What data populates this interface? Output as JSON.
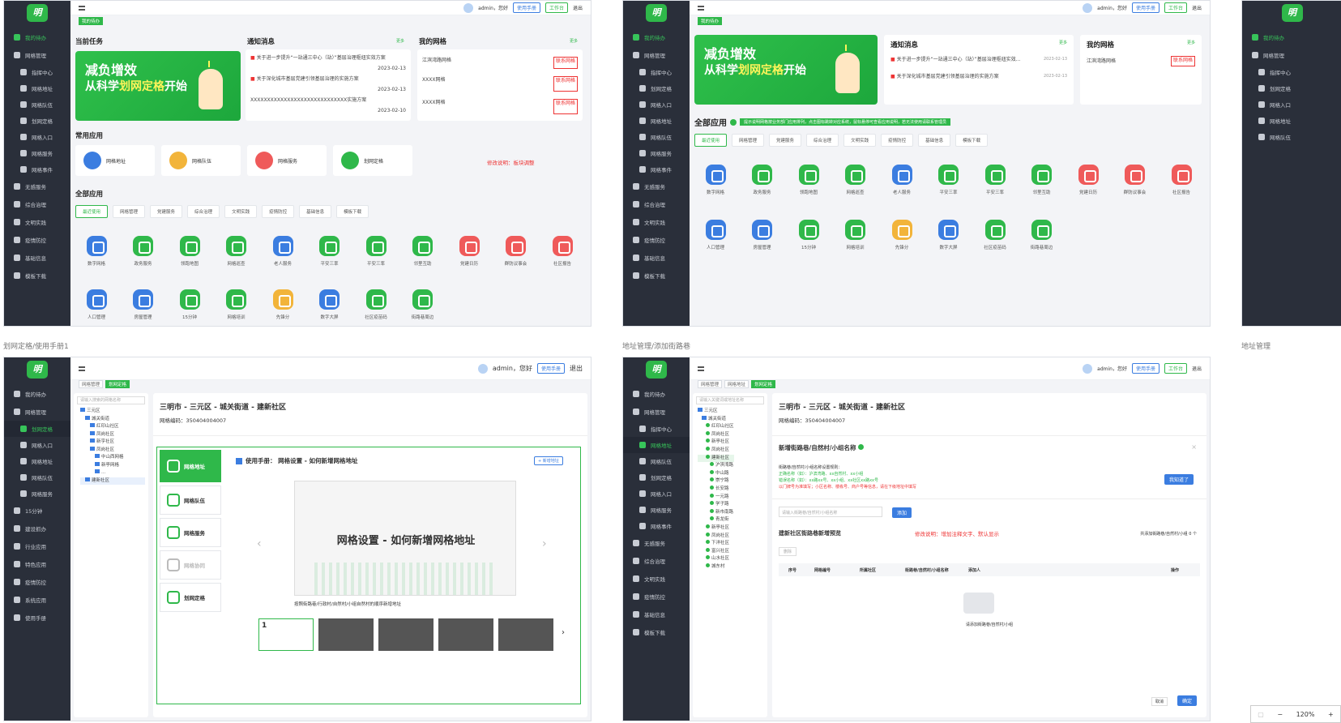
{
  "captions": {
    "bl": "划网定格/使用手册1",
    "br": "地址管理/添加街路巷",
    "far_right_1": "地址管理",
    "far_right_2": ""
  },
  "header": {
    "user": "admin，您好",
    "manual_btn": "使用手册",
    "workorder_btn": "工作台",
    "logout": "退出"
  },
  "sidebar_a": [
    "我的待办",
    "网格管理",
    "指挥中心",
    "网格地址",
    "网格队伍",
    "划网定格",
    "网格入口",
    "网格服务",
    "网格事件",
    "无感服务",
    "综合治理",
    "文明实践",
    "疫情防控",
    "基础信息",
    "模板下载"
  ],
  "sidebar_c": [
    "我的待办",
    "网格管理",
    "划网定格",
    "网格入口",
    "网格地址",
    "网格队伍",
    "网格服务",
    "15分钟",
    "建设抓办",
    "行业应用",
    "特色应用",
    "疫情防控",
    "系统应用",
    "使用手册"
  ],
  "sidebar_d": [
    "我的待办",
    "网格管理",
    "指挥中心",
    "网格地址",
    "网格队伍",
    "划网定格",
    "网格入口",
    "网格服务",
    "网格事件",
    "无感服务",
    "综合治理",
    "文明实践",
    "疫情防控",
    "基础信息",
    "模板下载"
  ],
  "tl": {
    "crumb": "我的待办",
    "current_task": "当前任务",
    "notice": "通知消息",
    "my_grid": "我的网格",
    "more": "更多",
    "banner1": "减负增效",
    "banner2_pre": "从科学",
    "banner2_hl": "划网定格",
    "banner2_post": "开始",
    "notices": [
      {
        "text": "关于进一步提升“一站通三中心（站）”基层治理枢纽实效方案",
        "date": "2023-02-13"
      },
      {
        "text": "关于深化城市基层党建引领基层治理的实施方案",
        "date": "2023-02-13"
      },
      {
        "text": "XXXXXXXXXXXXXXXXXXXXXXXXXXXXX实施方案",
        "date": "2023-02-10"
      }
    ],
    "grids": [
      {
        "name": "江滨湾路网格",
        "tag": "联系网格"
      },
      {
        "name": "XXXX网格",
        "tag": "联系网格"
      },
      {
        "name": "XXXX网格",
        "tag": "联系网格"
      }
    ],
    "common_apps": "常用应用",
    "commons": [
      "网格地址",
      "网格队伍",
      "网格服务",
      "划网定格"
    ],
    "modify_note": "修改说明：板块调整",
    "all_apps": "全部应用",
    "cats": [
      "最近使用",
      "网格管理",
      "党建服务",
      "综合治理",
      "文明实践",
      "疫情防控",
      "基础信息",
      "模板下载"
    ],
    "apps1": [
      "数字网格",
      "政务服务",
      "领跑地图",
      "网格巡查",
      "老人服务",
      "平安三率",
      "平安三率",
      "邻里互助",
      "党建日历",
      "群防议事会",
      "社区报告"
    ],
    "apps2": [
      "人口管理",
      "房屋管理",
      "15分钟",
      "网格培训",
      "先锋分",
      "数字大屏",
      "社区疫苗码",
      "街路巷周边"
    ]
  },
  "tr": {
    "crumb": "我的待办",
    "notice": "通知消息",
    "my_grid": "我的网格",
    "more": "更多",
    "notices": [
      {
        "text": "关于进一步提升“一站通三中心（站）”基层治理枢纽实效...",
        "date": "2023-02-13"
      },
      {
        "text": "关于深化城市基层党建引领基层治理的实施方案",
        "date": "2023-02-13"
      }
    ],
    "grid": "江滨湾路网格",
    "grid_tag": "联系网格",
    "all_apps": "全部应用",
    "tip": "提示说明网格按业务部门应用排列，点击图标跳转对应系统，鼠标悬停可查看应用说明，若无法使用请联系管理员",
    "cats": [
      "最近使用",
      "网格管理",
      "党建服务",
      "综合治理",
      "文明实践",
      "疫情防控",
      "基础信息",
      "模板下载"
    ],
    "apps1": [
      "数字网格",
      "政务服务",
      "领跑地图",
      "网格巡查",
      "老人服务",
      "平安三率",
      "平安三率",
      "邻里互助",
      "党建日历",
      "群防议事会",
      "社区报告"
    ],
    "apps2": [
      "人口管理",
      "房屋管理",
      "15分钟",
      "网格培训",
      "先锋分",
      "数字大屏",
      "社区疫苗码",
      "街路巷周边"
    ]
  },
  "bl": {
    "crumbs": [
      "网格管理",
      "划网定格"
    ],
    "search_ph": "请输入搜索的网格名称",
    "tree": [
      "三元区",
      "城关街道",
      "红印山社区",
      "凤岗社区",
      "新亨社区",
      "凤岗社区",
      "中山西网格",
      "新亭网格",
      "...",
      "建新社区"
    ],
    "address": "三明市 - 三元区 - 城关街道 - 建新社区",
    "grid_code": "网格编码：350404004007",
    "guides": [
      {
        "t": "网格地址",
        "s": "使用手册"
      },
      {
        "t": "网格队伍",
        "s": "使用手册"
      },
      {
        "t": "网格服务",
        "s": "使用手册"
      },
      {
        "t": "网格协同",
        "s": "使用手册"
      },
      {
        "t": "划网定格",
        "s": "使用手册"
      }
    ],
    "manual_title": "使用手册：  网格设置 - 如何新增网格地址",
    "add_btn": "+ 新增地址",
    "slide_title": "网格设置 - 如何新增网格地址",
    "slide_caption": "按照街路巷/行政村/自然村/小组自然村的顺序新增地址",
    "thumb_no": "1"
  },
  "br": {
    "crumbs": [
      "网格管理",
      "网格地址",
      "划网定格"
    ],
    "search_ph": "请输入关键词或地址名称",
    "tree": [
      "三元区",
      "城关街道",
      "红印山社区",
      "凤岗社区",
      "新亭社区",
      "凤岗社区",
      "建新社区",
      "沪滨湾路",
      "中山路",
      "崇宁路",
      "长安路",
      "一元路",
      "学子路",
      "新市南路",
      "青龙街",
      "新亭社区",
      "凤岗社区",
      "下洋社区",
      "富兴社区",
      "山水社区",
      "城东村"
    ],
    "address": "三明市 - 三元区 - 城关街道 - 建新社区",
    "grid_code": "网格编码：350404004007",
    "dialog_title": "新增街路巷/自然村/小组名称",
    "rule1": "街路巷/自然村/小组名称设置规则：",
    "rule2": "正确名称（如）：沪滨湾路、xx自然村、xx小组",
    "rule3": "错误名称（如）：xx路xx号、xx小组、xx社区xx路xx号",
    "rule_red": "以门牌号为准填写；小区名称、楼栋号、商户号等信息，请在下级地址中填写",
    "got_it": "我知道了",
    "input_ph": "请输入街路巷/自然村/小组名称",
    "add": "添加",
    "preview_title": "建新社区街路巷新增预览",
    "modify_note": "修改说明：增加注释文字、默认显示",
    "count": "共添加街路巷/自然村/小组 0 个",
    "del": "删除",
    "cols": [
      "序号",
      "网格编号",
      "所属社区",
      "街路巷/自然村/小组名称",
      "添加人",
      "操作"
    ],
    "empty": "请添加街路巷/自然村/小组",
    "cancel": "取消",
    "ok": "确定"
  },
  "zoom": {
    "minus": "−",
    "level": "120%",
    "plus": "+"
  }
}
